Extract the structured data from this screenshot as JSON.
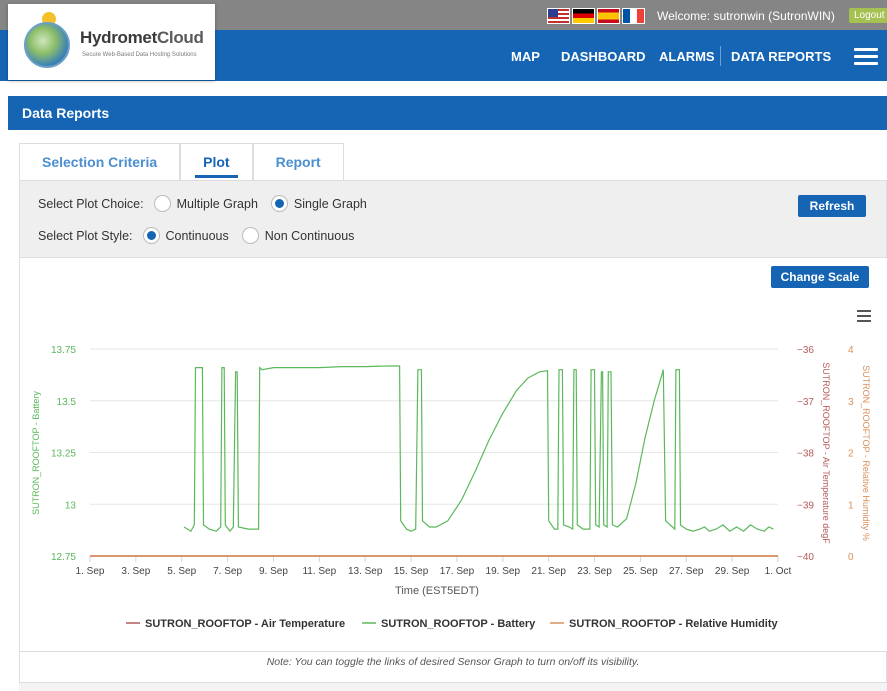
{
  "header": {
    "welcome": "Welcome: sutronwin (SutronWIN)",
    "logout_label": "Logout",
    "flags": [
      "english-flag",
      "german-flag",
      "spanish-flag",
      "french-flag"
    ]
  },
  "logo": {
    "title_part1": "Hydromet",
    "title_part2": "Cloud",
    "subtitle": "Secure Web-Based Data Hosting Solutions"
  },
  "nav": {
    "items": [
      "MAP",
      "DASHBOARD",
      "ALARMS",
      "DATA REPORTS"
    ]
  },
  "section": {
    "title": "Data Reports"
  },
  "tabs": [
    {
      "label": "Selection Criteria",
      "active": false
    },
    {
      "label": "Plot",
      "active": true
    },
    {
      "label": "Report",
      "active": false
    }
  ],
  "options": {
    "plot_choice_label": "Select Plot Choice:",
    "plot_choice_options": [
      "Multiple Graph",
      "Single Graph"
    ],
    "plot_choice_selected": "Single Graph",
    "plot_style_label": "Select Plot Style:",
    "plot_style_options": [
      "Continuous",
      "Non Continuous"
    ],
    "plot_style_selected": "Continuous",
    "refresh_label": "Refresh",
    "change_scale_label": "Change Scale"
  },
  "colors": {
    "brand_blue": "#1565b4",
    "battery": "#5cb85c",
    "air_temperature": "#b55a5a",
    "humidity": "#d9905a"
  },
  "chart_data": {
    "type": "line",
    "xlabel": "Time (EST5EDT)",
    "x_ticks": [
      "1. Sep",
      "3. Sep",
      "5. Sep",
      "7. Sep",
      "9. Sep",
      "11. Sep",
      "13. Sep",
      "15. Sep",
      "17. Sep",
      "19. Sep",
      "21. Sep",
      "23. Sep",
      "25. Sep",
      "27. Sep",
      "29. Sep",
      "1. Oct"
    ],
    "x_range": [
      "1. Sep",
      "1. Oct"
    ],
    "grid": true,
    "legend_position": "bottom",
    "y_axes": [
      {
        "label": "SUTRON_ROOFTOP - Battery",
        "side": "left",
        "ticks": [
          "12.75",
          "13",
          "13.25",
          "13.5",
          "13.75"
        ],
        "range": [
          12.75,
          13.75
        ]
      },
      {
        "label": "SUTRON_ROOFTOP - Air Temperature degF",
        "side": "right",
        "ticks": [
          "−40",
          "−39",
          "−38",
          "−37",
          "−36"
        ],
        "range": [
          -40,
          -36
        ]
      },
      {
        "label": "SUTRON_ROOFTOP - Relative Humidity %",
        "side": "right",
        "ticks": [
          "0",
          "1",
          "2",
          "3",
          "4"
        ],
        "range": [
          0,
          4
        ]
      }
    ],
    "series": [
      {
        "name": "SUTRON_ROOFTOP - Air Temperature",
        "axis": 1,
        "points": [
          [
            1,
            -40
          ],
          [
            31,
            -40
          ]
        ]
      },
      {
        "name": "SUTRON_ROOFTOP - Battery",
        "axis": 0,
        "points": [
          [
            5.1,
            12.89
          ],
          [
            5.4,
            12.87
          ],
          [
            5.55,
            12.9
          ],
          [
            5.6,
            13.66
          ],
          [
            5.9,
            13.66
          ],
          [
            5.95,
            12.9
          ],
          [
            6.2,
            12.88
          ],
          [
            6.5,
            12.87
          ],
          [
            6.7,
            12.89
          ],
          [
            6.75,
            13.66
          ],
          [
            6.85,
            13.66
          ],
          [
            6.9,
            12.9
          ],
          [
            7.1,
            12.87
          ],
          [
            7.25,
            12.89
          ],
          [
            7.35,
            13.64
          ],
          [
            7.42,
            13.64
          ],
          [
            7.47,
            12.89
          ],
          [
            7.9,
            12.88
          ],
          [
            8.35,
            12.88
          ],
          [
            8.4,
            13.66
          ],
          [
            8.5,
            13.65
          ],
          [
            9.0,
            13.66
          ],
          [
            10.0,
            13.66
          ],
          [
            11.0,
            13.66
          ],
          [
            12.0,
            13.665
          ],
          [
            13.0,
            13.665
          ],
          [
            14.0,
            13.668
          ],
          [
            14.5,
            13.668
          ],
          [
            14.55,
            12.92
          ],
          [
            14.8,
            12.88
          ],
          [
            15.0,
            12.87
          ],
          [
            15.2,
            12.88
          ],
          [
            15.3,
            13.65
          ],
          [
            15.45,
            13.65
          ],
          [
            15.5,
            12.92
          ],
          [
            15.8,
            12.89
          ],
          [
            16.1,
            12.89
          ],
          [
            16.6,
            12.92
          ],
          [
            17.2,
            13.02
          ],
          [
            17.8,
            13.16
          ],
          [
            18.4,
            13.31
          ],
          [
            19.0,
            13.44
          ],
          [
            19.6,
            13.55
          ],
          [
            20.1,
            13.61
          ],
          [
            20.6,
            13.64
          ],
          [
            20.95,
            13.645
          ],
          [
            21.0,
            12.92
          ],
          [
            21.25,
            12.88
          ],
          [
            21.4,
            12.88
          ],
          [
            21.45,
            13.65
          ],
          [
            21.6,
            13.65
          ],
          [
            21.65,
            12.9
          ],
          [
            21.9,
            12.89
          ],
          [
            22.05,
            12.88
          ],
          [
            22.1,
            13.65
          ],
          [
            22.2,
            13.65
          ],
          [
            22.25,
            12.9
          ],
          [
            22.5,
            12.88
          ],
          [
            22.8,
            12.88
          ],
          [
            22.85,
            13.65
          ],
          [
            23.0,
            13.65
          ],
          [
            23.05,
            12.9
          ],
          [
            23.2,
            12.89
          ],
          [
            23.3,
            13.64
          ],
          [
            23.35,
            13.64
          ],
          [
            23.4,
            12.9
          ],
          [
            23.55,
            12.89
          ],
          [
            23.6,
            13.64
          ],
          [
            23.72,
            13.64
          ],
          [
            23.78,
            12.9
          ],
          [
            24.0,
            12.89
          ],
          [
            24.4,
            12.93
          ],
          [
            24.8,
            13.1
          ],
          [
            25.2,
            13.32
          ],
          [
            25.6,
            13.5
          ],
          [
            25.95,
            13.63
          ],
          [
            26.0,
            13.65
          ],
          [
            26.1,
            12.92
          ],
          [
            26.4,
            12.89
          ],
          [
            26.5,
            12.88
          ],
          [
            26.55,
            13.65
          ],
          [
            26.7,
            13.65
          ],
          [
            26.75,
            12.9
          ],
          [
            27.0,
            12.88
          ],
          [
            27.3,
            12.87
          ],
          [
            27.6,
            12.88
          ],
          [
            27.8,
            12.89
          ],
          [
            28.0,
            12.87
          ],
          [
            28.3,
            12.88
          ],
          [
            28.6,
            12.9
          ],
          [
            28.9,
            12.87
          ],
          [
            29.2,
            12.89
          ],
          [
            29.5,
            12.87
          ],
          [
            29.8,
            12.9
          ],
          [
            30.1,
            12.88
          ],
          [
            30.4,
            12.87
          ],
          [
            30.6,
            12.89
          ],
          [
            30.8,
            12.88
          ]
        ]
      },
      {
        "name": "SUTRON_ROOFTOP - Relative Humidity",
        "axis": 2,
        "points": [
          [
            1,
            0
          ],
          [
            31,
            0
          ]
        ]
      }
    ]
  },
  "note": "Note: You can toggle the links of desired Sensor Graph to turn on/off its visibility."
}
